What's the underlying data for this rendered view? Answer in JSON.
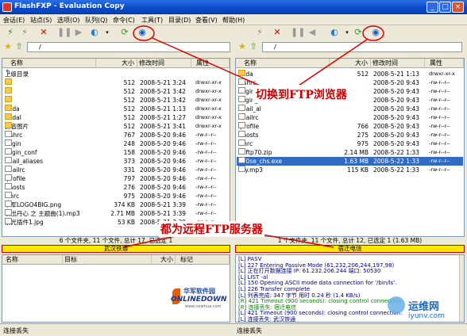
{
  "window": {
    "title": "FlashFXP - Evaluation Copy"
  },
  "menu": [
    "会话(E)",
    "站点(S)",
    "选项(O)",
    "队列(Q)",
    "命令(C)",
    "工具(T)",
    "目录(D)",
    "查看(V)",
    "帮助(H)"
  ],
  "left": {
    "path": "/",
    "headers": {
      "name": "名称",
      "size": "大小",
      "modified": "修改时间",
      "attr": "属性"
    },
    "rows": [
      {
        "name": "上级目录",
        "size": "",
        "date": "",
        "attr": "",
        "type": "up"
      },
      {
        "name": "1",
        "size": "512",
        "date": "2008-5-21 3:24",
        "attr": "drwxr-xr-x",
        "type": "folder"
      },
      {
        "name": "2",
        "size": "512",
        "date": "2008-5-21 3:42",
        "attr": "drwxr-xr-x",
        "type": "folder"
      },
      {
        "name": "3",
        "size": "512",
        "date": "2008-5-21 3:42",
        "attr": "drwxr-xr-x",
        "type": "folder"
      },
      {
        "name": "dada",
        "size": "512",
        "date": "2008-5-21 1:13",
        "attr": "drwxr-xr-x",
        "type": "folder"
      },
      {
        "name": "dadal",
        "size": "512",
        "date": "2008-5-21 1:27",
        "attr": "drwxr-xr-x",
        "type": "folder"
      },
      {
        "name": "拼音图片",
        "size": "512",
        "date": "2008-5-21 3:41",
        "attr": "drwxr-xr-x",
        "type": "folder"
      },
      {
        "name": ".cshrc",
        "size": "767",
        "date": "2008-5-20 9:46",
        "attr": "-rw-r--r--",
        "type": "file"
      },
      {
        "name": ".login",
        "size": "248",
        "date": "2008-5-20 9:46",
        "attr": "-rw-r--r--",
        "type": "file"
      },
      {
        "name": ".login_conf",
        "size": "158",
        "date": "2008-5-20 9:46",
        "attr": "-rw-r--r--",
        "type": "file"
      },
      {
        "name": ".mail_aliases",
        "size": "373",
        "date": "2008-5-20 9:46",
        "attr": "-rw-r--r--",
        "type": "file"
      },
      {
        "name": ".mailrc",
        "size": "331",
        "date": "2008-5-20 9:46",
        "attr": "-rw-r--r--",
        "type": "file"
      },
      {
        "name": ".profile",
        "size": "797",
        "date": "2008-5-20 9:46",
        "attr": "-rw-r--r--",
        "type": "file"
      },
      {
        "name": ".rhosts",
        "size": "276",
        "date": "2008-5-20 9:46",
        "attr": "-rw-r--r--",
        "type": "file"
      },
      {
        "name": ".shrc",
        "size": "975",
        "date": "2008-5-20 9:46",
        "attr": "-rw-r--r--",
        "type": "file"
      },
      {
        "name": "华军LOGO4BIG.png",
        "size": "374 KB",
        "date": "2008-5-21 3:39",
        "attr": "-rw-r--r--",
        "type": "file"
      },
      {
        "name": "轶出丹心 之 主题曲(1).mp3",
        "size": "2.71 MB",
        "date": "2008-5-21 3:39",
        "attr": "-rw-r--r--",
        "type": "file"
      },
      {
        "name": "紫光插件1.jpg",
        "size": "53 KB",
        "date": "2008-5-21 3:39",
        "attr": "-rw-r--r--",
        "type": "file"
      }
    ],
    "status": "6 个文件夹, 11 个文件, 总计 17, 已选定 1",
    "site": "武汉铁通"
  },
  "right": {
    "path": "/",
    "headers": {
      "name": "名称",
      "size": "大小",
      "modified": "修改时间",
      "attr": "属性"
    },
    "rows": [
      {
        "name": "dada",
        "size": "512",
        "date": "2008-5-21 1:13",
        "attr": "drwxr-xr-x",
        "type": "folder",
        "sel": false
      },
      {
        "name": ".cshrc",
        "size": "",
        "date": "2008-5-20 9:43",
        "attr": "-rw-r--r--",
        "type": "file",
        "sel": false
      },
      {
        "name": ".login",
        "size": "",
        "date": "2008-5-20 9:43",
        "attr": "-rw-r--r--",
        "type": "file",
        "sel": false
      },
      {
        "name": ".login_co",
        "size": "",
        "date": "2008-5-20 9:43",
        "attr": "-rw-r--r--",
        "type": "file",
        "sel": false
      },
      {
        "name": ".mail_al",
        "size": "",
        "date": "2008-5-20 9:43",
        "attr": "-rw-r--r--",
        "type": "file",
        "sel": false
      },
      {
        "name": ".mailrc",
        "size": "",
        "date": "2008-5-20 9:43",
        "attr": "-rw-r--r--",
        "type": "file",
        "sel": false
      },
      {
        "name": ".profile",
        "size": "766",
        "date": "2008-5-20 9:43",
        "attr": "-rw-r--r--",
        "type": "file",
        "sel": false
      },
      {
        "name": ".rhosts",
        "size": "275",
        "date": "2008-5-20 9:43",
        "attr": "-rw-r--r--",
        "type": "file",
        "sel": false
      },
      {
        "name": ".shrc",
        "size": "975",
        "date": "2008-5-20 9:43",
        "attr": "-rw-r--r--",
        "type": "file",
        "sel": false
      },
      {
        "name": "3dftp70.zip",
        "size": "2.14 MB",
        "date": "2008-5-22 1:33",
        "attr": "-rw-r--r--",
        "type": "file",
        "sel": false
      },
      {
        "name": "360se_chs.exe",
        "size": "1.63 MB",
        "date": "2008-5-22 1:33",
        "attr": "-rw-r--r--",
        "type": "file",
        "sel": true
      },
      {
        "name": "Lily.mp3",
        "size": "115 KB",
        "date": "2008-5-22 1:33",
        "attr": "-rw-r--r--",
        "type": "file",
        "sel": false
      }
    ],
    "status": "1 个文件夹, 11 个文件, 总计 12, 已选定 1 (1.63 MB)",
    "site": "宿迁电信"
  },
  "queue": {
    "headers": {
      "name": "名称",
      "target": "目标",
      "size": "大小",
      "tag": "标记"
    }
  },
  "log": [
    "[L] PASV",
    "[L] 227 Entering Passive Mode (61,232,206,244,197,98)",
    "[L] 正在打开数据连接 IP: 61.232.206.244 端口: 50530",
    "[L] LIST -al",
    "[L] 150 Opening ASCII mode data connection for '/bin/ls'.",
    "[L] 226 Transfer complete",
    "[L] 列表完成: 347 字节 用时 0.24 秒 (1.4 KB/s)",
    "[R] 421 Timeout (900 seconds): closing control connection.",
    "[R] 连接丢失: 宿迁电信",
    "[L] 421 Timeout (900 seconds): closing control connection.",
    "[L] 连接丢失: 武汉铁通"
  ],
  "bottom": {
    "left": "连接丢失",
    "right": "连接丢失"
  },
  "annotations": {
    "switch": "切换到FTP浏览器",
    "remote": "都为远程FTP服务器"
  },
  "logo": {
    "cn": "华军软件园",
    "en": "ONLINEDOWN",
    "url": "www.newhua.com"
  },
  "watermark": {
    "name": "运维网",
    "url": "iyunv.com"
  }
}
